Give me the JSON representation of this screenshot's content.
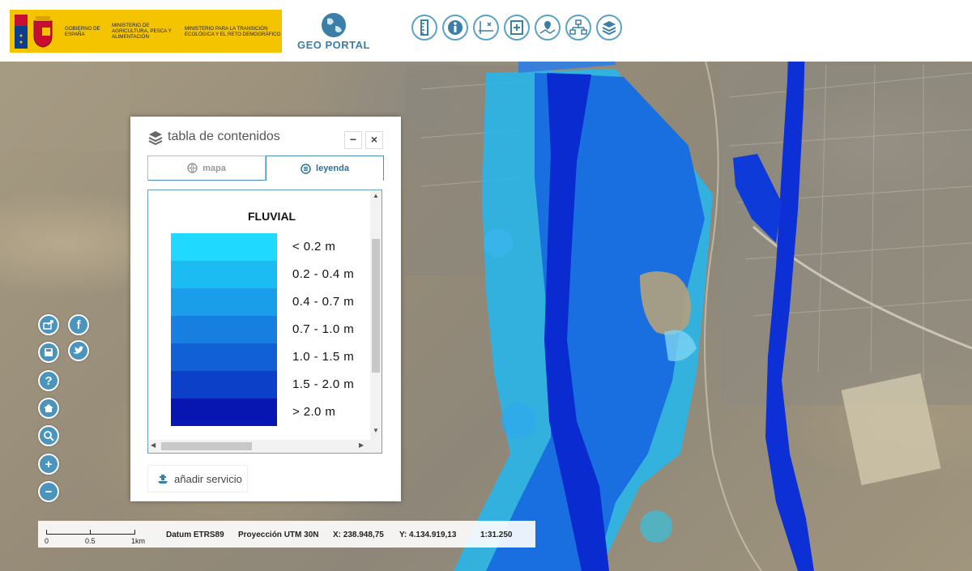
{
  "header": {
    "gov_text_1": "GOBIERNO DE ESPAÑA",
    "gov_text_2": "MINISTERIO DE AGRICULTURA, PESCA Y ALIMENTACIÓN",
    "gov_text_3": "MINISTERIO PARA LA TRANSICIÓN ECOLÓGICA Y EL RETO DEMOGRÁFICO",
    "portal_name": "GEO PORTAL"
  },
  "toolbar": {
    "tools": [
      "ruler-icon",
      "info-icon",
      "coordinates-icon",
      "bookmark-icon",
      "map-location-icon",
      "sitemap-icon",
      "layers-icon"
    ]
  },
  "controls": {
    "left": [
      "share-icon",
      "facebook-icon",
      "save-icon",
      "twitter-icon",
      "help-icon",
      "home-icon",
      "zoom-box-icon",
      "zoom-in-icon",
      "zoom-out-icon"
    ],
    "facebook_glyph": "f",
    "help_glyph": "?",
    "zoom_in_glyph": "+",
    "zoom_out_glyph": "−"
  },
  "toc": {
    "title": "tabla de contenidos",
    "minimize": "−",
    "close": "×",
    "tabs": [
      {
        "label": "mapa",
        "active": false
      },
      {
        "label": "leyenda",
        "active": true
      }
    ],
    "legend_title": "FLUVIAL",
    "legend_items": [
      {
        "label": "< 0.2 m",
        "color": "#1fd9ff"
      },
      {
        "label": "0.2 - 0.4 m",
        "color": "#1bbcf2"
      },
      {
        "label": "0.4 - 0.7 m",
        "color": "#1a9ee9"
      },
      {
        "label": "0.7 - 1.0 m",
        "color": "#177fe0"
      },
      {
        "label": "1.0 - 1.5 m",
        "color": "#1260d6"
      },
      {
        "label": "1.5 - 2.0 m",
        "color": "#0c40c8"
      },
      {
        "label": "> 2.0 m",
        "color": "#0716b0"
      }
    ],
    "add_service": "añadir servicio"
  },
  "status": {
    "scale_labels": [
      "0",
      "0.5",
      "1km"
    ],
    "datum": "Datum ETRS89",
    "projection": "Proyección UTM 30N",
    "x": "X: 238.948,75",
    "y": "Y: 4.134.919,13",
    "scale": "1:31.250"
  }
}
